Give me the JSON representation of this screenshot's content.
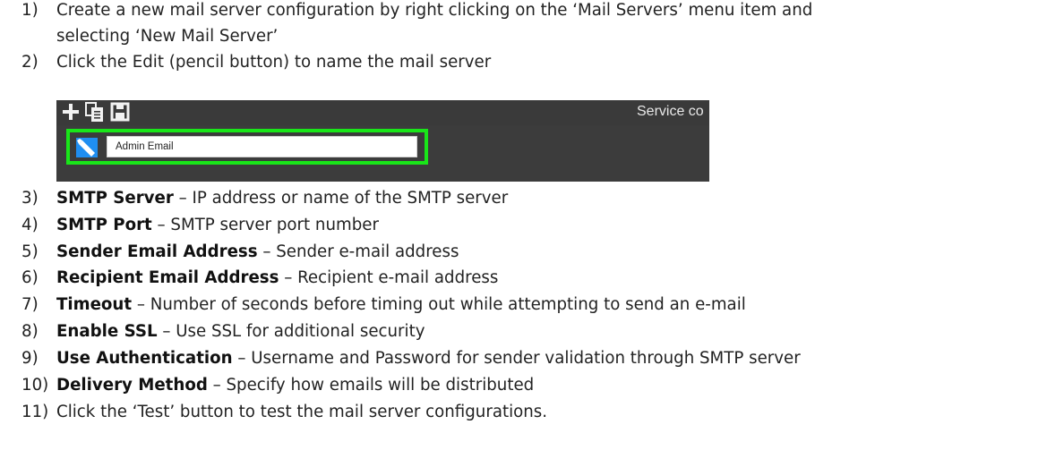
{
  "steps": [
    {
      "num": "1)",
      "text": "Create a new mail server configuration by right clicking on the ‘Mail Servers’ menu item and",
      "cont": "selecting ‘New Mail Server’"
    },
    {
      "num": "2)",
      "text": "Click the Edit (pencil button) to name the mail server"
    },
    {
      "num": "3)",
      "term": "SMTP Server",
      "desc": " – IP address or name of the SMTP server"
    },
    {
      "num": "4)",
      "term": "SMTP Port",
      "desc": " – SMTP server port number"
    },
    {
      "num": "5)",
      "term": "Sender Email Address",
      "desc": " – Sender e-mail address"
    },
    {
      "num": "6)",
      "term": "Recipient Email Address",
      "desc": " – Recipient e-mail address"
    },
    {
      "num": "7)",
      "term": "Timeout",
      "desc": " – Number of seconds before timing out while attempting to send an e-mail"
    },
    {
      "num": "8)",
      "term": "Enable SSL",
      "desc": " – Use SSL for additional security"
    },
    {
      "num": "9)",
      "term": "Use Authentication",
      "desc": " – Username and Password for sender validation through SMTP server"
    },
    {
      "num": "10)",
      "term": "Delivery Method",
      "desc": " – Specify how emails will be distributed"
    },
    {
      "num": "11)",
      "text": "Click the ‘Test’ button to test the mail server configurations."
    }
  ],
  "screenshot": {
    "toolbar_icons": [
      "plus-icon",
      "copy-icon",
      "save-icon"
    ],
    "service_text": "Service co",
    "name_field_value": "Admin Email",
    "highlight_color": "#19e619",
    "edit_button_color": "#1f8ef1"
  }
}
